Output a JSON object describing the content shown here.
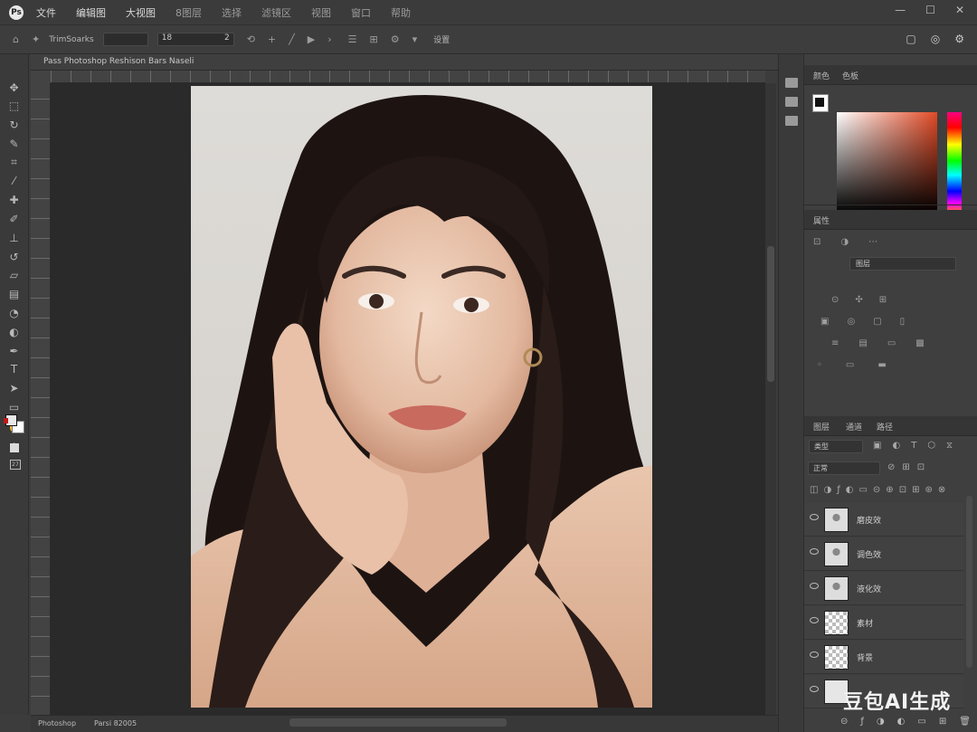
{
  "menu": {
    "items": [
      "文件",
      "编辑图",
      "大视图",
      "8图层",
      "选择",
      "滤镜区",
      "视图",
      "窗口",
      "帮助"
    ]
  },
  "window_controls": {
    "minimize": "—",
    "maximize": "☐",
    "close": "✕"
  },
  "options_bar": {
    "preset_label": "TrimSoarks",
    "field_value": "18",
    "field_value2": "2",
    "mode_label": "设置"
  },
  "document": {
    "tab_title": "Pass Photoshop Reshison Bars Naseli",
    "status_left": "Photoshop",
    "status_right": "Parsi 82005"
  },
  "color_panel": {
    "tabs": [
      "颜色",
      "色板"
    ]
  },
  "properties_panel": {
    "title": "属性",
    "field_value": "图层"
  },
  "layers_panel": {
    "tabs": [
      "图层",
      "通道",
      "路径"
    ],
    "kind_filter": "类型",
    "blend_mode": "正常",
    "layers": [
      {
        "name": "磨皮效",
        "thumb": "photo"
      },
      {
        "name": "调色效",
        "thumb": "photo"
      },
      {
        "name": "液化效",
        "thumb": "photo"
      },
      {
        "name": "素材",
        "thumb": "check"
      },
      {
        "name": "背景",
        "thumb": "check"
      },
      {
        "name": "",
        "thumb": "white"
      }
    ]
  },
  "watermark": "豆包AI生成",
  "colors": {
    "foreground": "#111111",
    "background": "#ffffff",
    "accent_red": "#c01818"
  }
}
